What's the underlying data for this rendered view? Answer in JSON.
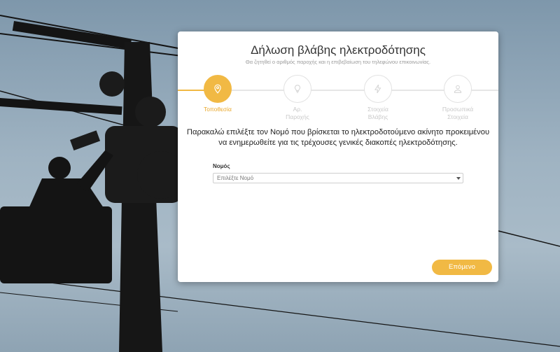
{
  "form": {
    "title": "Δήλωση βλάβης ηλεκτροδότησης",
    "subtitle": "Θα ζητηθεί ο αριθμός παροχής και η επιβεβαίωση του τηλεφώνου επικοινωνίας.",
    "steps": [
      {
        "label": "Τοποθεσία",
        "icon": "location-pin-icon",
        "active": true
      },
      {
        "label": "Αρ.\nΠαροχής",
        "icon": "lightbulb-icon",
        "active": false
      },
      {
        "label": "Στοιχεία\nΒλάβης",
        "icon": "lightning-bolt-icon",
        "active": false
      },
      {
        "label": "Προσωπικά\nΣτοιχεία",
        "icon": "user-icon",
        "active": false
      }
    ],
    "instruction": "Παρακαλώ επιλέξτε τον Νομό που βρίσκεται το ηλεκτροδοτούμενο ακίνητο προκειμένου να ενημερωθείτε για τις τρέχουσες γενικές διακοπές ηλεκτροδότησης.",
    "prefecture_label": "Νομός",
    "prefecture_placeholder": "Επιλέξτε Νομό",
    "next_button": "Επόμενο"
  },
  "colors": {
    "accent": "#f1b944",
    "inactive": "#c8c8c8"
  }
}
